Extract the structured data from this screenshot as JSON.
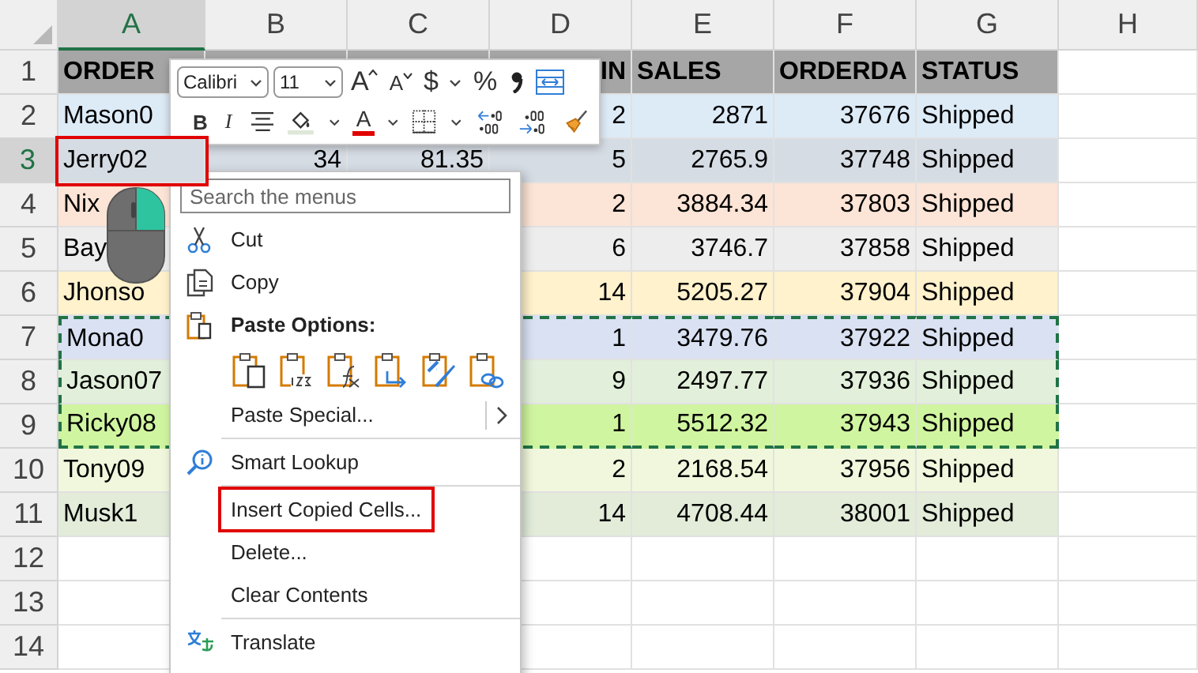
{
  "sheet": {
    "columns": [
      {
        "label": "A",
        "selected": true
      },
      {
        "label": "B",
        "selected": false
      },
      {
        "label": "C",
        "selected": false
      },
      {
        "label": "D",
        "selected": false
      },
      {
        "label": "E",
        "selected": false
      },
      {
        "label": "F",
        "selected": false
      },
      {
        "label": "G",
        "selected": false
      },
      {
        "label": "H",
        "selected": false
      }
    ],
    "rows": [
      {
        "number": "1",
        "selected": false,
        "kind": "header",
        "color": "#a6a6a6",
        "copied": false,
        "cells": {
          "a": {
            "kind": "text",
            "text": "ORDER",
            "boxed": false
          },
          "d": {
            "kind": "number",
            "text": "IN",
            "boxed": false
          },
          "e": {
            "kind": "text",
            "text": "SALES",
            "boxed": false
          },
          "f": {
            "kind": "text",
            "text": "ORDERDA",
            "boxed": false
          },
          "g": {
            "kind": "text",
            "text": "STATUS",
            "boxed": false
          }
        }
      },
      {
        "number": "2",
        "selected": false,
        "kind": "data",
        "color": "#ddebf7",
        "copied": false,
        "cells": {
          "a": {
            "kind": "text",
            "text": "Mason0",
            "boxed": false
          },
          "d": {
            "kind": "number",
            "text": "2",
            "boxed": false
          },
          "e": {
            "kind": "number",
            "text": "2871",
            "boxed": false
          },
          "f": {
            "kind": "number",
            "text": "37676",
            "boxed": false
          },
          "g": {
            "kind": "text",
            "text": "Shipped",
            "boxed": false
          }
        }
      },
      {
        "number": "3",
        "selected": true,
        "kind": "data",
        "color": "#d6dce4",
        "copied": false,
        "cells": {
          "a": {
            "kind": "text",
            "text": "Jerry02",
            "boxed": true
          },
          "b": {
            "kind": "number",
            "text": "34",
            "boxed": false
          },
          "c": {
            "kind": "number",
            "text": "81.35",
            "boxed": false
          },
          "d": {
            "kind": "number",
            "text": "5",
            "boxed": false
          },
          "e": {
            "kind": "number",
            "text": "2765.9",
            "boxed": false
          },
          "f": {
            "kind": "number",
            "text": "37748",
            "boxed": false
          },
          "g": {
            "kind": "text",
            "text": "Shipped",
            "boxed": false
          }
        }
      },
      {
        "number": "4",
        "selected": false,
        "kind": "data",
        "color": "#fce4d6",
        "copied": false,
        "cells": {
          "a": {
            "kind": "text",
            "text": "Nix",
            "boxed": false
          },
          "d": {
            "kind": "number",
            "text": "2",
            "boxed": false
          },
          "e": {
            "kind": "number",
            "text": "3884.34",
            "boxed": false
          },
          "f": {
            "kind": "number",
            "text": "37803",
            "boxed": false
          },
          "g": {
            "kind": "text",
            "text": "Shipped",
            "boxed": false
          }
        }
      },
      {
        "number": "5",
        "selected": false,
        "kind": "data",
        "color": "#ededed",
        "copied": false,
        "cells": {
          "a": {
            "kind": "text",
            "text": "Bay",
            "boxed": false
          },
          "d": {
            "kind": "number",
            "text": "6",
            "boxed": false
          },
          "e": {
            "kind": "number",
            "text": "3746.7",
            "boxed": false
          },
          "f": {
            "kind": "number",
            "text": "37858",
            "boxed": false
          },
          "g": {
            "kind": "text",
            "text": "Shipped",
            "boxed": false
          }
        }
      },
      {
        "number": "6",
        "selected": false,
        "kind": "data",
        "color": "#fff2cc",
        "copied": false,
        "cells": {
          "a": {
            "kind": "text",
            "text": "Jhonso",
            "boxed": false
          },
          "d": {
            "kind": "number",
            "text": "14",
            "boxed": false
          },
          "e": {
            "kind": "number",
            "text": "5205.27",
            "boxed": false
          },
          "f": {
            "kind": "number",
            "text": "37904",
            "boxed": false
          },
          "g": {
            "kind": "text",
            "text": "Shipped",
            "boxed": false
          }
        }
      },
      {
        "number": "7",
        "selected": false,
        "kind": "data",
        "color": "#d9e1f2",
        "copied": true,
        "cells": {
          "a": {
            "kind": "text",
            "text": "Mona0",
            "boxed": false
          },
          "d": {
            "kind": "number",
            "text": "1",
            "boxed": false
          },
          "e": {
            "kind": "number",
            "text": "3479.76",
            "boxed": false
          },
          "f": {
            "kind": "number",
            "text": "37922",
            "boxed": false
          },
          "g": {
            "kind": "text",
            "text": "Shipped",
            "boxed": false
          }
        }
      },
      {
        "number": "8",
        "selected": false,
        "kind": "data",
        "color": "#e2efda",
        "copied": true,
        "cells": {
          "a": {
            "kind": "text",
            "text": "Jason07",
            "boxed": false
          },
          "d": {
            "kind": "number",
            "text": "9",
            "boxed": false
          },
          "e": {
            "kind": "number",
            "text": "2497.77",
            "boxed": false
          },
          "f": {
            "kind": "number",
            "text": "37936",
            "boxed": false
          },
          "g": {
            "kind": "text",
            "text": "Shipped",
            "boxed": false
          }
        }
      },
      {
        "number": "9",
        "selected": false,
        "kind": "data",
        "color": "#d0f5a0",
        "copied": true,
        "cells": {
          "a": {
            "kind": "text",
            "text": "Ricky08",
            "boxed": false
          },
          "d": {
            "kind": "number",
            "text": "1",
            "boxed": false
          },
          "e": {
            "kind": "number",
            "text": "5512.32",
            "boxed": false
          },
          "f": {
            "kind": "number",
            "text": "37943",
            "boxed": false
          },
          "g": {
            "kind": "text",
            "text": "Shipped",
            "boxed": false
          }
        }
      },
      {
        "number": "10",
        "selected": false,
        "kind": "data",
        "color": "#f0f7dc",
        "copied": false,
        "cells": {
          "a": {
            "kind": "text",
            "text": "Tony09",
            "boxed": false
          },
          "d": {
            "kind": "number",
            "text": "2",
            "boxed": false
          },
          "e": {
            "kind": "number",
            "text": "2168.54",
            "boxed": false
          },
          "f": {
            "kind": "number",
            "text": "37956",
            "boxed": false
          },
          "g": {
            "kind": "text",
            "text": "Shipped",
            "boxed": false
          }
        }
      },
      {
        "number": "11",
        "selected": false,
        "kind": "data",
        "color": "#e2ecd9",
        "copied": false,
        "cells": {
          "a": {
            "kind": "text",
            "text": "Musk1",
            "boxed": false
          },
          "d": {
            "kind": "number",
            "text": "14",
            "boxed": false
          },
          "e": {
            "kind": "number",
            "text": "4708.44",
            "boxed": false
          },
          "f": {
            "kind": "number",
            "text": "38001",
            "boxed": false
          },
          "g": {
            "kind": "text",
            "text": "Shipped",
            "boxed": false
          }
        }
      },
      {
        "number": "12",
        "selected": false,
        "kind": "data",
        "copied": false
      },
      {
        "number": "13",
        "selected": false,
        "kind": "data",
        "copied": false
      },
      {
        "number": "14",
        "selected": false,
        "kind": "data",
        "copied": false
      }
    ]
  },
  "mini_toolbar": {
    "font": "Calibri",
    "size": "11",
    "grow_font": "A",
    "shrink_font": "A",
    "currency": "$",
    "percent": "%",
    "bold": "B",
    "italic": "I",
    "font_color": "A"
  },
  "context_menu": {
    "search": {
      "placeholder": "Search the menus"
    },
    "items": [
      {
        "kind": "cut",
        "label": "Cut",
        "boxed": false
      },
      {
        "kind": "copy",
        "label": "Copy",
        "boxed": false
      },
      {
        "kind": "heading",
        "label": "Paste Options:",
        "boxed": false
      },
      {
        "kind": "paste"
      },
      {
        "kind": "submenu",
        "label": "Paste Special...",
        "boxed": false
      },
      {
        "kind": "separator"
      },
      {
        "kind": "lookup",
        "label": "Smart Lookup",
        "boxed": false
      },
      {
        "kind": "separator"
      },
      {
        "kind": "plain",
        "label": "Insert Copied Cells...",
        "boxed": true
      },
      {
        "kind": "plain",
        "label": "Delete...",
        "boxed": false
      },
      {
        "kind": "plain",
        "label": "Clear Contents",
        "boxed": false
      },
      {
        "kind": "separator"
      },
      {
        "kind": "translate",
        "label": "Translate",
        "boxed": false
      }
    ]
  }
}
